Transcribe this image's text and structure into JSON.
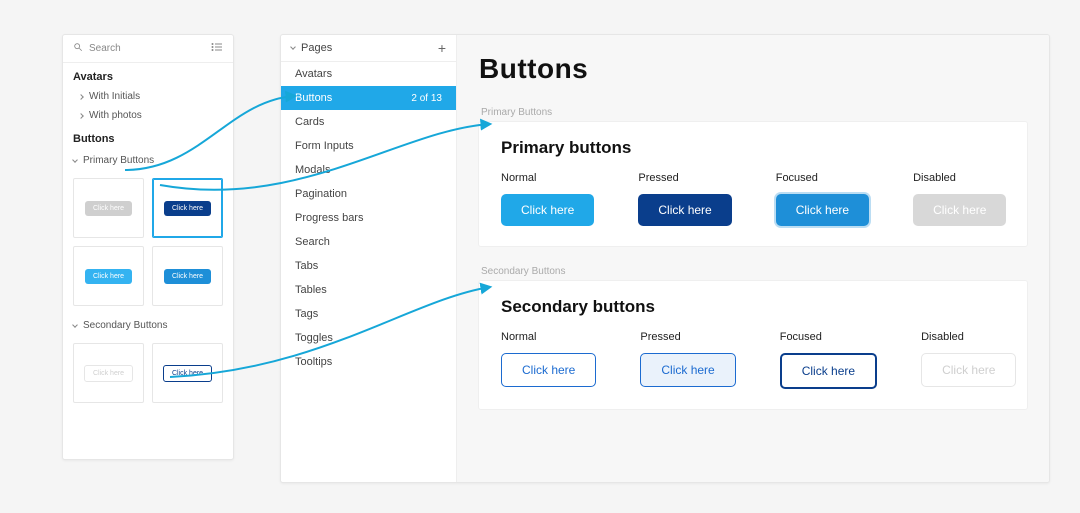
{
  "palette": {
    "search_placeholder": "Search",
    "sections": {
      "avatars": {
        "title": "Avatars",
        "items": [
          "With Initials",
          "With photos"
        ]
      },
      "buttons": {
        "title": "Buttons",
        "groups": {
          "primary": {
            "title": "Primary Buttons",
            "thumb_label": "Click here"
          },
          "secondary": {
            "title": "Secondary Buttons",
            "thumb_label": "Click here"
          }
        }
      }
    }
  },
  "pages_panel": {
    "title": "Pages",
    "active_count": "2 of 13",
    "items": [
      "Avatars",
      "Buttons",
      "Cards",
      "Form Inputs",
      "Modals",
      "Pagination",
      "Progress bars",
      "Search",
      "Tabs",
      "Tables",
      "Tags",
      "Toggles",
      "Tooltips"
    ]
  },
  "canvas": {
    "page_title": "Buttons",
    "frames": {
      "primary": {
        "frame_label": "Primary Buttons",
        "heading": "Primary buttons",
        "states": {
          "normal": {
            "label": "Normal",
            "text": "Click here"
          },
          "pressed": {
            "label": "Pressed",
            "text": "Click here"
          },
          "focused": {
            "label": "Focused",
            "text": "Click here"
          },
          "disabled": {
            "label": "Disabled",
            "text": "Click here"
          }
        }
      },
      "secondary": {
        "frame_label": "Secondary Buttons",
        "heading": "Secondary buttons",
        "states": {
          "normal": {
            "label": "Normal",
            "text": "Click here"
          },
          "pressed": {
            "label": "Pressed",
            "text": "Click here"
          },
          "focused": {
            "label": "Focused",
            "text": "Click here"
          },
          "disabled": {
            "label": "Disabled",
            "text": "Click here"
          }
        }
      }
    }
  }
}
